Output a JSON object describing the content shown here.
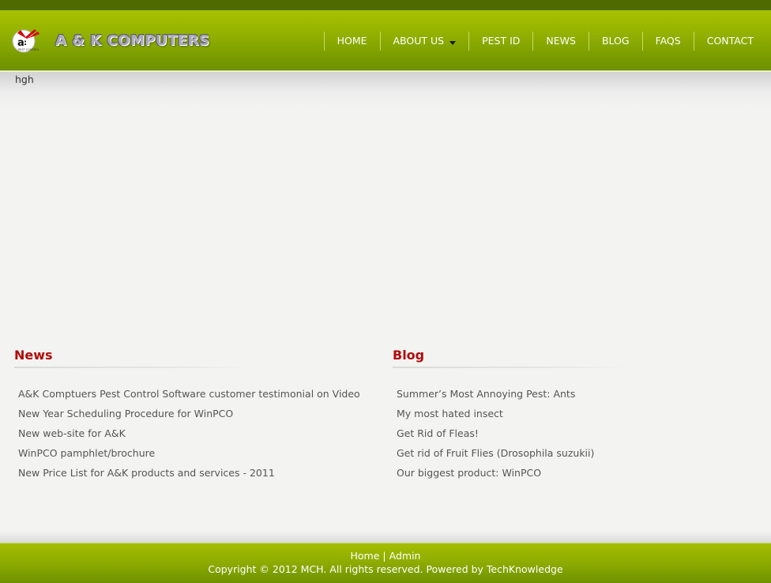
{
  "header": {
    "brand": "A & K COMPUTERS",
    "logo_icon": "ak-logo-icon",
    "nav": [
      {
        "label": "HOME"
      },
      {
        "label": "ABOUT US",
        "has_dropdown": true
      },
      {
        "label": "PEST ID"
      },
      {
        "label": "NEWS"
      },
      {
        "label": "BLOG"
      },
      {
        "label": "FAQS"
      },
      {
        "label": "CONTACT"
      }
    ]
  },
  "main": {
    "intro_text": "hgh",
    "news": {
      "title": "News",
      "items": [
        "A&K Comptuers Pest Control Software customer testimonial on Video",
        "New Year Scheduling Procedure for WinPCO",
        "New web-site for A&K",
        "WinPCO pamphlet/brochure",
        "New Price List for A&K products and services - 2011"
      ]
    },
    "blog": {
      "title": "Blog",
      "items": [
        "Summer’s Most Annoying Pest: Ants",
        "My most hated insect",
        "Get Rid of Fleas!",
        "Get rid of Fruit Flies (Drosophila suzukii)",
        "Our biggest product: WinPCO"
      ]
    }
  },
  "footer": {
    "links": [
      "Home",
      "Admin"
    ],
    "separator": "|",
    "copyright": "Copyright © 2012 MCH. All rights reserved. Powered by TechKnowledge"
  },
  "colors": {
    "header_green": "#8fae00",
    "top_bar": "#4e6a00",
    "section_title_red": "#b00c0c",
    "page_bg": "#f3f3f2"
  }
}
